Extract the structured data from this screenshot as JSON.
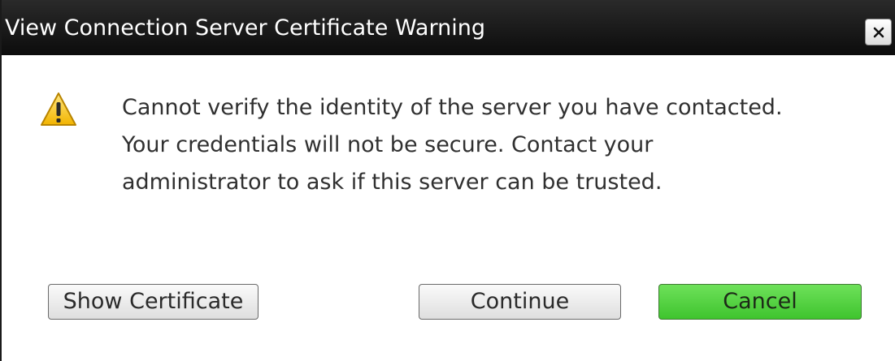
{
  "dialog": {
    "title": "View Connection Server Certificate Warning",
    "close_icon": "close-icon",
    "warning_icon": "warning-triangle-icon",
    "message_lines": [
      "Cannot verify the identity of the server you have contacted.",
      "Your credentials will not be secure. Contact your",
      "administrator to ask if this server can be trusted."
    ],
    "buttons": {
      "show_certificate": "Show Certificate",
      "continue": "Continue",
      "cancel": "Cancel"
    },
    "colors": {
      "titlebar": "#111111",
      "cancel_accent": "#4fd23c",
      "warning_yellow": "#f5c400"
    }
  }
}
